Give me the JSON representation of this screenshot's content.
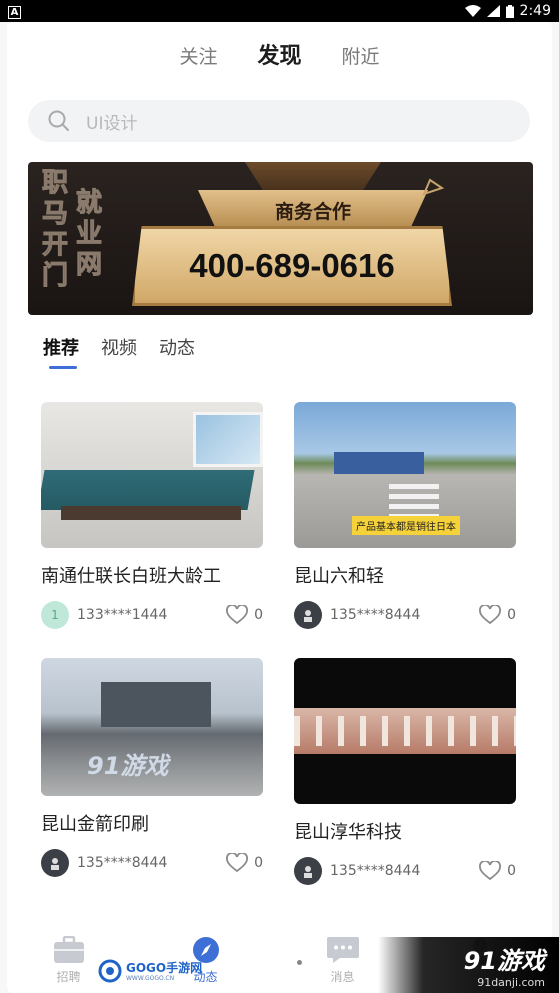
{
  "status_bar": {
    "left_icon": "A",
    "time": "2:49"
  },
  "top_tabs": [
    {
      "label": "关注",
      "active": false
    },
    {
      "label": "发现",
      "active": true
    },
    {
      "label": "附近",
      "active": false
    }
  ],
  "search": {
    "placeholder": "UI设计"
  },
  "banner": {
    "brand_chars": [
      "职",
      "马",
      "开",
      "门",
      "就",
      "业",
      "网"
    ],
    "subtitle": "商务合作",
    "phone": "400-689-0616"
  },
  "sub_tabs": [
    {
      "label": "推荐",
      "active": true
    },
    {
      "label": "视频",
      "active": false
    },
    {
      "label": "动态",
      "active": false
    }
  ],
  "posts": [
    {
      "title": "南通仕联长白班大龄工",
      "user": "133****1444",
      "avatar_text": "1",
      "likes": "0"
    },
    {
      "title": "昆山六和轻",
      "user": "135****8444",
      "avatar_text": "",
      "likes": "0",
      "image_caption": "产品基本都是销往日本"
    },
    {
      "title": "昆山金箭印刷",
      "user": "135****8444",
      "avatar_text": "",
      "likes": "0",
      "image_watermark": "91游戏"
    },
    {
      "title": "昆山淳华科技",
      "user": "135****8444",
      "avatar_text": "",
      "likes": "0"
    }
  ],
  "bottom_nav": [
    {
      "label": "招聘",
      "icon": "briefcase-icon",
      "active": false
    },
    {
      "label": "动态",
      "icon": "compass-icon",
      "active": true
    },
    {
      "label": "消息",
      "icon": "chat-icon",
      "active": false
    },
    {
      "label": "",
      "icon": "profile-icon",
      "active": false
    }
  ],
  "watermarks": {
    "gogo": "GOGO手游网",
    "gogo_url": "WWW.GOGO.CN",
    "site91": "91游戏",
    "site91_url": "91danji.com"
  },
  "colors": {
    "accent": "#3d6fd6",
    "search_bg": "#f2f3f5"
  }
}
